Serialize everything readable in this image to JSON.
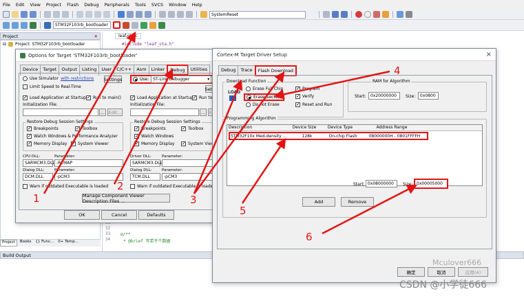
{
  "menu": [
    "File",
    "Edit",
    "View",
    "Project",
    "Flash",
    "Debug",
    "Peripherals",
    "Tools",
    "SVCS",
    "Window",
    "Help"
  ],
  "toolbar": {
    "target_name": "SystemReset",
    "project_combo": "STM32F103rb_bootloader"
  },
  "project_panel": {
    "title": "Project",
    "root": "Project: STM32F103rb_bootloader",
    "bottom_tabs": [
      "Project",
      "Books",
      "{} Func...",
      "0+ Temp..."
    ]
  },
  "editor": {
    "tab": "leaf.ota.c",
    "code_top": "#include \"leaf_ota.h\"",
    "line_numbers": [
      "31",
      "32",
      "33",
      "34"
    ],
    "line_34": "* @brief 写若干个数据"
  },
  "build_output": {
    "title": "Build Output"
  },
  "options_dialog": {
    "title": "Options for Target 'STM32F103rb_bootloader'",
    "tabs": [
      "Device",
      "Target",
      "Output",
      "Listing",
      "User",
      "C/C++",
      "Asm",
      "Linker",
      "Debug",
      "Utilities"
    ],
    "left": {
      "use_simulator": "Use Simulator",
      "with_restrictions": "with restrictions",
      "settings": "Settings",
      "limit_speed": "Limit Speed to Real-Time",
      "load_app": "Load Application at Startup",
      "run_to_main": "Run to main()",
      "init_file": "Initialization File:",
      "edit": "Edit...",
      "restore_group": "Restore Debug Session Settings",
      "breakpoints": "Breakpoints",
      "toolbox": "Toolbox",
      "watch_windows": "Watch Windows & Performance Analyzer",
      "memory_display": "Memory Display",
      "system_viewer": "System Viewer",
      "cpu_dll": "CPU DLL:",
      "parameter": "Parameter:",
      "cpu_dll_val": "SARMCM3.DLL",
      "cpu_param_val": "-REMAP",
      "dialog_dll": "Dialog DLL:",
      "dialog_dll_val": "DCM.DLL",
      "dialog_param_val": "-pCM3",
      "warn": "Warn if outdated Executable is loaded"
    },
    "right": {
      "use": "Use:",
      "debugger": "ST-Link Debugger",
      "settings": "Settings",
      "load_app": "Load Application at Startup",
      "run_to_main": "Run to main()",
      "init_file": "Initialization File:",
      "edit": "Edit...",
      "restore_group": "Restore Debug Session Settings",
      "breakpoints": "Breakpoints",
      "toolbox": "Toolbox",
      "watch_windows": "Watch Windows",
      "memory_display": "Memory Display",
      "system_viewer": "System Viewer",
      "driver_dll": "Driver DLL:",
      "parameter": "Parameter:",
      "driver_dll_val": "SARMCM3.DLL",
      "dialog_dll": "Dialog DLL:",
      "dialog_dll_val": "TCM.DLL",
      "dialog_param_val": "-pCM3",
      "warn": "Warn if outdated Executable is loaded"
    },
    "manage_btn": "Manage Component Viewer Description Files ...",
    "ok": "OK",
    "cancel": "Cancel",
    "defaults": "Defaults"
  },
  "driver_dialog": {
    "title": "Cortex-M Target Driver Setup",
    "close": "×",
    "tabs": [
      "Debug",
      "Trace",
      "Flash Download"
    ],
    "download_function": "Download Function",
    "load_label": "LOAD",
    "erase_full_chip": "Erase Full Chip",
    "erase_sectors": "Erase Sectors",
    "do_not_erase": "Do not Erase",
    "program": "Program",
    "verify": "Verify",
    "reset_and_run": "Reset and Run",
    "ram_group": "RAM for Algorithm",
    "start_label": "Start:",
    "ram_start": "0x20000000",
    "size_label": "Size:",
    "ram_size": "0x0800",
    "prog_algo": "Programming Algorithm",
    "columns": [
      "Description",
      "Device Size",
      "Device Type",
      "Address Range"
    ],
    "rows": [
      {
        "description": "STM32F10x Med-density ...",
        "size": "128k",
        "type": "On-chip Flash",
        "range": "08000000H - 0801FFFFH"
      }
    ],
    "algo_start": "0x08000000",
    "algo_size": "0x00005000",
    "add": "Add",
    "remove": "Remove",
    "confirm": "确定",
    "cancel": "取消",
    "apply": "应用(A)"
  },
  "annotations": [
    "1",
    "2",
    "3",
    "4",
    "5",
    "6"
  ],
  "watermarks": [
    "Mculover666",
    "CSDN @小学徒666"
  ],
  "colors": {
    "red": "#e31414",
    "title_bg": "#ffffff",
    "dialog_bg": "#f0f0f0"
  }
}
